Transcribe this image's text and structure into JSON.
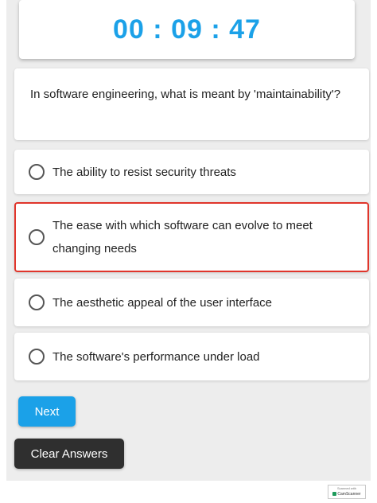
{
  "timer": {
    "display": "00 : 09 : 47"
  },
  "question": {
    "text": "In software engineering, what is meant by 'maintainability'?"
  },
  "options": [
    {
      "label": "The ability to resist security threats",
      "selected": false,
      "highlighted": false
    },
    {
      "label": "The ease with which software can evolve to meet changing needs",
      "selected": false,
      "highlighted": true
    },
    {
      "label": "The aesthetic appeal of the user interface",
      "selected": false,
      "highlighted": false
    },
    {
      "label": "The software's performance under load",
      "selected": false,
      "highlighted": false
    }
  ],
  "buttons": {
    "next": "Next",
    "clear": "Clear Answers"
  },
  "watermark": {
    "line1": "Scanned with",
    "line2": "CamScanner"
  },
  "colors": {
    "accent": "#1ba1e8",
    "highlight_border": "#e0352b",
    "dark_button": "#2f2f2f"
  }
}
